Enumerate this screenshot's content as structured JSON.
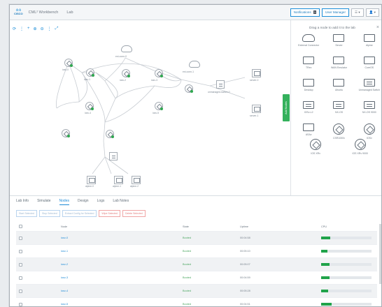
{
  "header": {
    "logo_bars": "ılıılı",
    "logo_text": "CISCO",
    "app_title": "CML² Workbench",
    "lab_name": "Lab",
    "notifications_label": "Notifications",
    "notifications_count": "3",
    "user_manager_label": "User Manager",
    "menu_label": "☰ ▾",
    "user_label": "👤 ▾"
  },
  "canvas": {
    "tools": [
      "⟳",
      "⋮",
      "+",
      "⊕",
      "⊖",
      "⋮",
      "⤢"
    ],
    "nodes": [
      "ext-conn-0",
      "ext-conn-1",
      "iosv-0",
      "iosv-1",
      "iosv-2",
      "iosv-3",
      "iosv-4",
      "iosv-5",
      "unmanaged-switch-0",
      "server-0",
      "server-1",
      "alpine-0",
      "alpine-1",
      "alpine-2",
      "iosv-6"
    ]
  },
  "palette": {
    "title": "Drag a node to add it to the lab",
    "close": "×",
    "items": [
      "External Connector",
      "Server",
      "Alpine",
      "TRex",
      "WAN Emulator",
      "CoreOS",
      "Desktop",
      "Ubuntu",
      "Unmanaged Switch",
      "IOSv-L2",
      "NX-OS",
      "NX-OS 9000",
      "ASAv",
      "CSR1000v",
      "IOSv",
      "IOS XRv",
      "IOS XRv 9000"
    ],
    "side_tab": "Add Nodes"
  },
  "bottom": {
    "tabs": [
      "Lab Info",
      "Simulate",
      "Nodes",
      "Design",
      "Logs",
      "Lab Notes"
    ],
    "active_tab": "Nodes",
    "actions": [
      "Start Selected",
      "Stop Selected",
      "Extract Config for Selected",
      "Wipe Selected",
      "Delete Selected"
    ],
    "columns": [
      "Node",
      "State",
      "Uptime",
      "CPU"
    ],
    "rows": [
      {
        "name": "iosv-0",
        "state": "Booted",
        "uptime": "00:04:58",
        "cpu": 0.18,
        "cpu_text": "18"
      },
      {
        "name": "iosv-1",
        "state": "Booted",
        "uptime": "00:05:10",
        "cpu": 0.12,
        "cpu_text": "12"
      },
      {
        "name": "iosv-2",
        "state": "Booted",
        "uptime": "00:05:07",
        "cpu": 0.17,
        "cpu_text": "17"
      },
      {
        "name": "iosv-3",
        "state": "Booted",
        "uptime": "00:04:59",
        "cpu": 0.16,
        "cpu_text": "16"
      },
      {
        "name": "iosv-4",
        "state": "Booted",
        "uptime": "00:05:28",
        "cpu": 0.14,
        "cpu_text": "14"
      },
      {
        "name": "iosv-5",
        "state": "Booted",
        "uptime": "00:04:51",
        "cpu": 0.21,
        "cpu_text": "21"
      }
    ]
  },
  "colors": {
    "accent": "#1d8ad6",
    "success": "#2fa84f",
    "danger": "#e17b7b"
  }
}
